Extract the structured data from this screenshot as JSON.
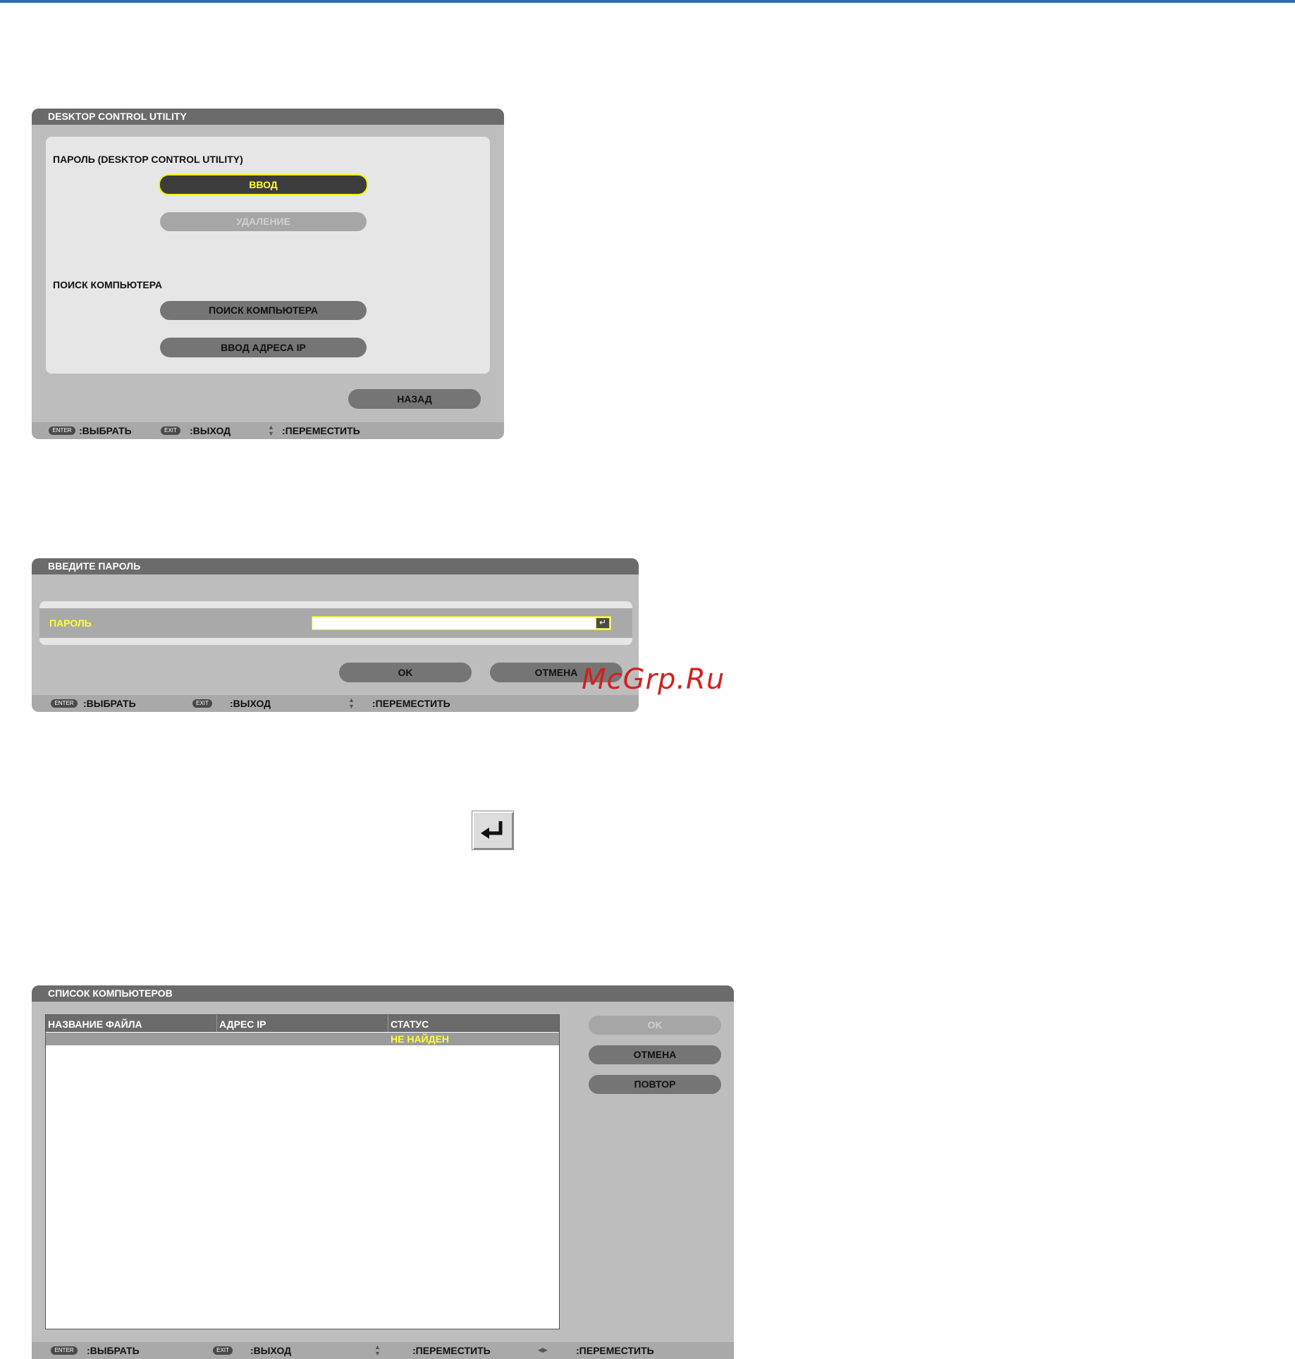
{
  "dialog1": {
    "title": "DESKTOP CONTROL UTILITY",
    "section_password_label": "ПАРОЛЬ (DESKTOP CONTROL UTILITY)",
    "enter_button": "ВВОД",
    "delete_button": "УДАЛЕНИЕ",
    "section_search_label": "ПОИСК КОМПЬЮТЕРА",
    "search_button": "ПОИСК КОМПЬЮТЕРА",
    "ip_button": "ВВОД АДРЕСА IP",
    "back_button": "НАЗАД",
    "footer": {
      "enter_key": "ENTER",
      "enter_text": ":ВЫБРАТЬ",
      "exit_key": "EXIT",
      "exit_text": ":ВЫХОД",
      "move_text": ":ПЕРЕМЕСТИТЬ"
    }
  },
  "dialog2": {
    "title": "ВВЕДИТЕ ПАРОЛЬ",
    "password_label": "ПАРОЛЬ",
    "password_value": "",
    "ok_button": "OK",
    "cancel_button": "ОТМЕНА",
    "footer": {
      "enter_key": "ENTER",
      "enter_text": ":ВЫБРАТЬ",
      "exit_key": "EXIT",
      "exit_text": ":ВЫХОД",
      "move_text": ":ПЕРЕМЕСТИТЬ"
    }
  },
  "watermark": "McGrp.Ru",
  "dialog3": {
    "title": "СПИСОК КОМПЬЮТЕРОВ",
    "columns": [
      "НАЗВАНИЕ ФАЙЛА",
      "АДРЕС IP",
      "СТАТУС"
    ],
    "rows": [
      {
        "name": "",
        "ip": "",
        "status": "НЕ НАЙДЕН"
      }
    ],
    "ok_button": "OK",
    "cancel_button": "ОТМЕНА",
    "retry_button": "ПОВТОР",
    "footer": {
      "enter_key": "ENTER",
      "enter_text": ":ВЫБРАТЬ",
      "exit_key": "EXIT",
      "exit_text": ":ВЫХОД",
      "move_ud_text": ":ПЕРЕМЕСТИТЬ",
      "move_lr_text": ":ПЕРЕМЕСТИТЬ"
    }
  },
  "colors": {
    "accent_yellow": "#ffff33",
    "title_bar": "#6b6b6b",
    "dialog_bg": "#bdbdbd",
    "top_rule": "#2a6fb5",
    "watermark": "#d32020"
  }
}
